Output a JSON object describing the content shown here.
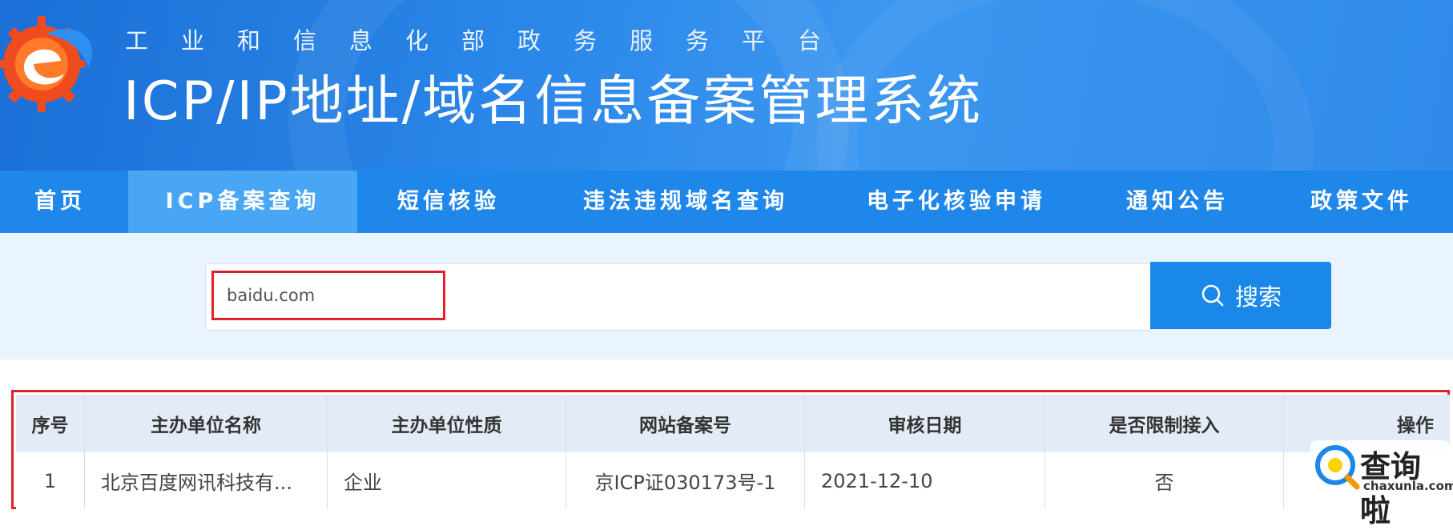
{
  "header": {
    "subtitle": "工业和信息化部政务服务平台",
    "title": "ICP/IP地址/域名信息备案管理系统"
  },
  "nav": {
    "items": [
      {
        "label": "首页"
      },
      {
        "label": "ICP备案查询"
      },
      {
        "label": "短信核验"
      },
      {
        "label": "违法违规域名查询"
      },
      {
        "label": "电子化核验申请"
      },
      {
        "label": "通知公告"
      },
      {
        "label": "政策文件"
      }
    ],
    "active_index": 1
  },
  "search": {
    "value": "baidu.com",
    "button_label": "搜索",
    "icon": "search-icon"
  },
  "results": {
    "columns": [
      "序号",
      "主办单位名称",
      "主办单位性质",
      "网站备案号",
      "审核日期",
      "是否限制接入",
      "操作"
    ],
    "rows": [
      [
        "1",
        "北京百度网讯科技有...",
        "企业",
        "京ICP证030173号-1",
        "2021-12-10",
        "否",
        ""
      ]
    ]
  },
  "watermark": {
    "cn": "查询啦",
    "en": "chaxunla.com"
  },
  "colors": {
    "banner": "#2a86e8",
    "nav": "#1f87ea",
    "nav_active": "#49a6f5",
    "search_band": "#eaf4fe",
    "search_button": "#1a88e8",
    "highlight_border": "#e0212b",
    "table_header": "#e3ebf6"
  }
}
